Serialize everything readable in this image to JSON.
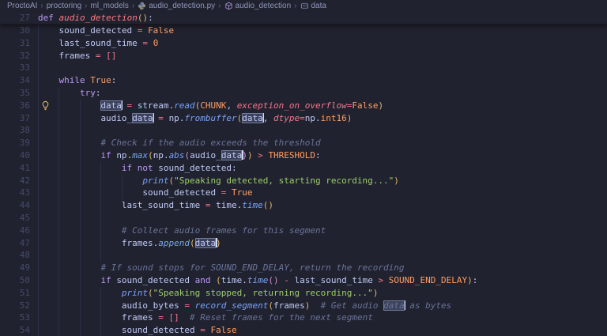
{
  "breadcrumb": {
    "separator": "›",
    "items": [
      {
        "label": "ProctoAI"
      },
      {
        "label": "proctoring"
      },
      {
        "label": "ml_models"
      },
      {
        "label": "audio_detection.py",
        "icon": "python-file-icon"
      },
      {
        "label": "audio_detection",
        "icon": "symbol-method-icon"
      },
      {
        "label": "data",
        "icon": "symbol-variable-icon"
      }
    ]
  },
  "editor": {
    "language": "python",
    "selected_word": "data",
    "sticky_line": {
      "n": "27",
      "ind": 0,
      "g": 0,
      "t": [
        [
          "kw",
          "def "
        ],
        [
          "fndef",
          "audio_detection"
        ],
        [
          "p1",
          "()"
        ],
        [
          "punct",
          ":"
        ]
      ]
    },
    "lightbulb": {
      "line": "36",
      "icon": "lightbulb-icon",
      "color": "#e2b86b"
    },
    "lines": [
      {
        "n": "30",
        "ind": 4,
        "g": 1,
        "t": [
          [
            "var",
            "sound_detected"
          ],
          [
            "op",
            " = "
          ],
          [
            "const",
            "False"
          ]
        ]
      },
      {
        "n": "31",
        "ind": 4,
        "g": 1,
        "t": [
          [
            "var",
            "last_sound_time"
          ],
          [
            "op",
            " = "
          ],
          [
            "const",
            "0"
          ]
        ]
      },
      {
        "n": "32",
        "ind": 4,
        "g": 1,
        "t": [
          [
            "var",
            "frames"
          ],
          [
            "op",
            " = "
          ],
          [
            "op",
            "[]"
          ]
        ]
      },
      {
        "n": "33",
        "ind": 0,
        "g": 1,
        "t": []
      },
      {
        "n": "34",
        "ind": 4,
        "g": 1,
        "t": [
          [
            "kw",
            "while "
          ],
          [
            "const",
            "True"
          ],
          [
            "punct",
            ":"
          ]
        ]
      },
      {
        "n": "35",
        "ind": 8,
        "g": 2,
        "t": [
          [
            "kw",
            "try"
          ],
          [
            "punct",
            ":"
          ]
        ]
      },
      {
        "n": "36",
        "ind": 12,
        "g": 3,
        "t": [
          [
            "sel",
            "data"
          ],
          [
            "op",
            " = "
          ],
          [
            "var",
            "stream"
          ],
          [
            "punct",
            "."
          ],
          [
            "fn",
            "read"
          ],
          [
            "p1",
            "("
          ],
          [
            "const",
            "CHUNK"
          ],
          [
            "punct",
            ", "
          ],
          [
            "param",
            "exception_on_overflow"
          ],
          [
            "op",
            "="
          ],
          [
            "const",
            "False"
          ],
          [
            "p1",
            ")"
          ]
        ]
      },
      {
        "n": "37",
        "ind": 12,
        "g": 3,
        "t": [
          [
            "var",
            "audio_"
          ],
          [
            "sel",
            "data"
          ],
          [
            "op",
            " = "
          ],
          [
            "var",
            "np"
          ],
          [
            "punct",
            "."
          ],
          [
            "fn",
            "frombuffer"
          ],
          [
            "p1",
            "("
          ],
          [
            "sel",
            "data"
          ],
          [
            "punct",
            ", "
          ],
          [
            "param",
            "dtype"
          ],
          [
            "op",
            "="
          ],
          [
            "var",
            "np"
          ],
          [
            "punct",
            "."
          ],
          [
            "const",
            "int16"
          ],
          [
            "p1",
            ")"
          ]
        ]
      },
      {
        "n": "38",
        "ind": 0,
        "g": 3,
        "t": []
      },
      {
        "n": "39",
        "ind": 12,
        "g": 3,
        "t": [
          [
            "com",
            "# Check if the audio exceeds the threshold"
          ]
        ]
      },
      {
        "n": "40",
        "ind": 12,
        "g": 3,
        "t": [
          [
            "kw",
            "if "
          ],
          [
            "var",
            "np"
          ],
          [
            "punct",
            "."
          ],
          [
            "fn",
            "max"
          ],
          [
            "p1",
            "("
          ],
          [
            "var",
            "np"
          ],
          [
            "punct",
            "."
          ],
          [
            "fn",
            "abs"
          ],
          [
            "p2",
            "("
          ],
          [
            "var",
            "audio_"
          ],
          [
            "sel",
            "data"
          ],
          [
            "p2",
            ")"
          ],
          [
            "p1",
            ")"
          ],
          [
            "op",
            " > "
          ],
          [
            "const",
            "THRESHOLD"
          ],
          [
            "punct",
            ":"
          ]
        ]
      },
      {
        "n": "41",
        "ind": 16,
        "g": 4,
        "t": [
          [
            "kw",
            "if not "
          ],
          [
            "var",
            "sound_detected"
          ],
          [
            "punct",
            ":"
          ]
        ]
      },
      {
        "n": "42",
        "ind": 20,
        "g": 5,
        "t": [
          [
            "fn",
            "print"
          ],
          [
            "p1",
            "("
          ],
          [
            "str",
            "\"Speaking detected, starting recording...\""
          ],
          [
            "p1",
            ")"
          ]
        ]
      },
      {
        "n": "43",
        "ind": 20,
        "g": 5,
        "t": [
          [
            "var",
            "sound_detected"
          ],
          [
            "op",
            " = "
          ],
          [
            "const",
            "True"
          ]
        ]
      },
      {
        "n": "44",
        "ind": 16,
        "g": 4,
        "t": [
          [
            "var",
            "last_sound_time"
          ],
          [
            "op",
            " = "
          ],
          [
            "var",
            "time"
          ],
          [
            "punct",
            "."
          ],
          [
            "fn",
            "time"
          ],
          [
            "p1",
            "()"
          ]
        ]
      },
      {
        "n": "45",
        "ind": 0,
        "g": 4,
        "t": []
      },
      {
        "n": "46",
        "ind": 16,
        "g": 4,
        "t": [
          [
            "com",
            "# Collect audio frames for this segment"
          ]
        ]
      },
      {
        "n": "47",
        "ind": 16,
        "g": 4,
        "t": [
          [
            "var",
            "frames"
          ],
          [
            "punct",
            "."
          ],
          [
            "fn",
            "append"
          ],
          [
            "p1",
            "("
          ],
          [
            "sel",
            "data"
          ],
          [
            "p1",
            ")"
          ]
        ]
      },
      {
        "n": "48",
        "ind": 0,
        "g": 4,
        "t": []
      },
      {
        "n": "49",
        "ind": 12,
        "g": 3,
        "t": [
          [
            "com",
            "# If sound stops for SOUND_END_DELAY, return the recording"
          ]
        ]
      },
      {
        "n": "50",
        "ind": 12,
        "g": 3,
        "t": [
          [
            "kw",
            "if "
          ],
          [
            "var",
            "sound_detected"
          ],
          [
            "kw",
            " and "
          ],
          [
            "p1",
            "("
          ],
          [
            "var",
            "time"
          ],
          [
            "punct",
            "."
          ],
          [
            "fn",
            "time"
          ],
          [
            "p2",
            "()"
          ],
          [
            "op",
            " - "
          ],
          [
            "var",
            "last_sound_time"
          ],
          [
            "op",
            " > "
          ],
          [
            "const",
            "SOUND_END_DELAY"
          ],
          [
            "p1",
            ")"
          ],
          [
            "punct",
            ":"
          ]
        ]
      },
      {
        "n": "51",
        "ind": 16,
        "g": 4,
        "t": [
          [
            "fn",
            "print"
          ],
          [
            "p1",
            "("
          ],
          [
            "str",
            "\"Speaking stopped, returning recording...\""
          ],
          [
            "p1",
            ")"
          ]
        ]
      },
      {
        "n": "52",
        "ind": 16,
        "g": 4,
        "t": [
          [
            "var",
            "audio_bytes"
          ],
          [
            "op",
            " = "
          ],
          [
            "fn",
            "record_segment"
          ],
          [
            "p1",
            "("
          ],
          [
            "var",
            "frames"
          ],
          [
            "p1",
            ")"
          ],
          [
            "com",
            "  # Get audio "
          ],
          [
            "selc",
            "data"
          ],
          [
            "com",
            " as bytes"
          ]
        ]
      },
      {
        "n": "53",
        "ind": 16,
        "g": 4,
        "t": [
          [
            "var",
            "frames"
          ],
          [
            "op",
            " = "
          ],
          [
            "op",
            "[]"
          ],
          [
            "com",
            "  # Reset frames for the next segment"
          ]
        ]
      },
      {
        "n": "54",
        "ind": 16,
        "g": 4,
        "t": [
          [
            "var",
            "sound_detected"
          ],
          [
            "op",
            " = "
          ],
          [
            "const",
            "False"
          ]
        ]
      }
    ]
  },
  "colors": {
    "background": "#20222f",
    "keyword": "#bb9af7",
    "function_call": "#7aa2f7",
    "function_def": "#ff7a85",
    "constant": "#ff9e64",
    "operator": "#f7768e",
    "string": "#9ece6a",
    "comment": "#6b7499",
    "bracket_level1": "#e0b76b",
    "bracket_level2": "#cf8fd4",
    "line_number": "#444b6a",
    "breadcrumb_text": "#9097ba",
    "lightbulb": "#e2b86b"
  }
}
